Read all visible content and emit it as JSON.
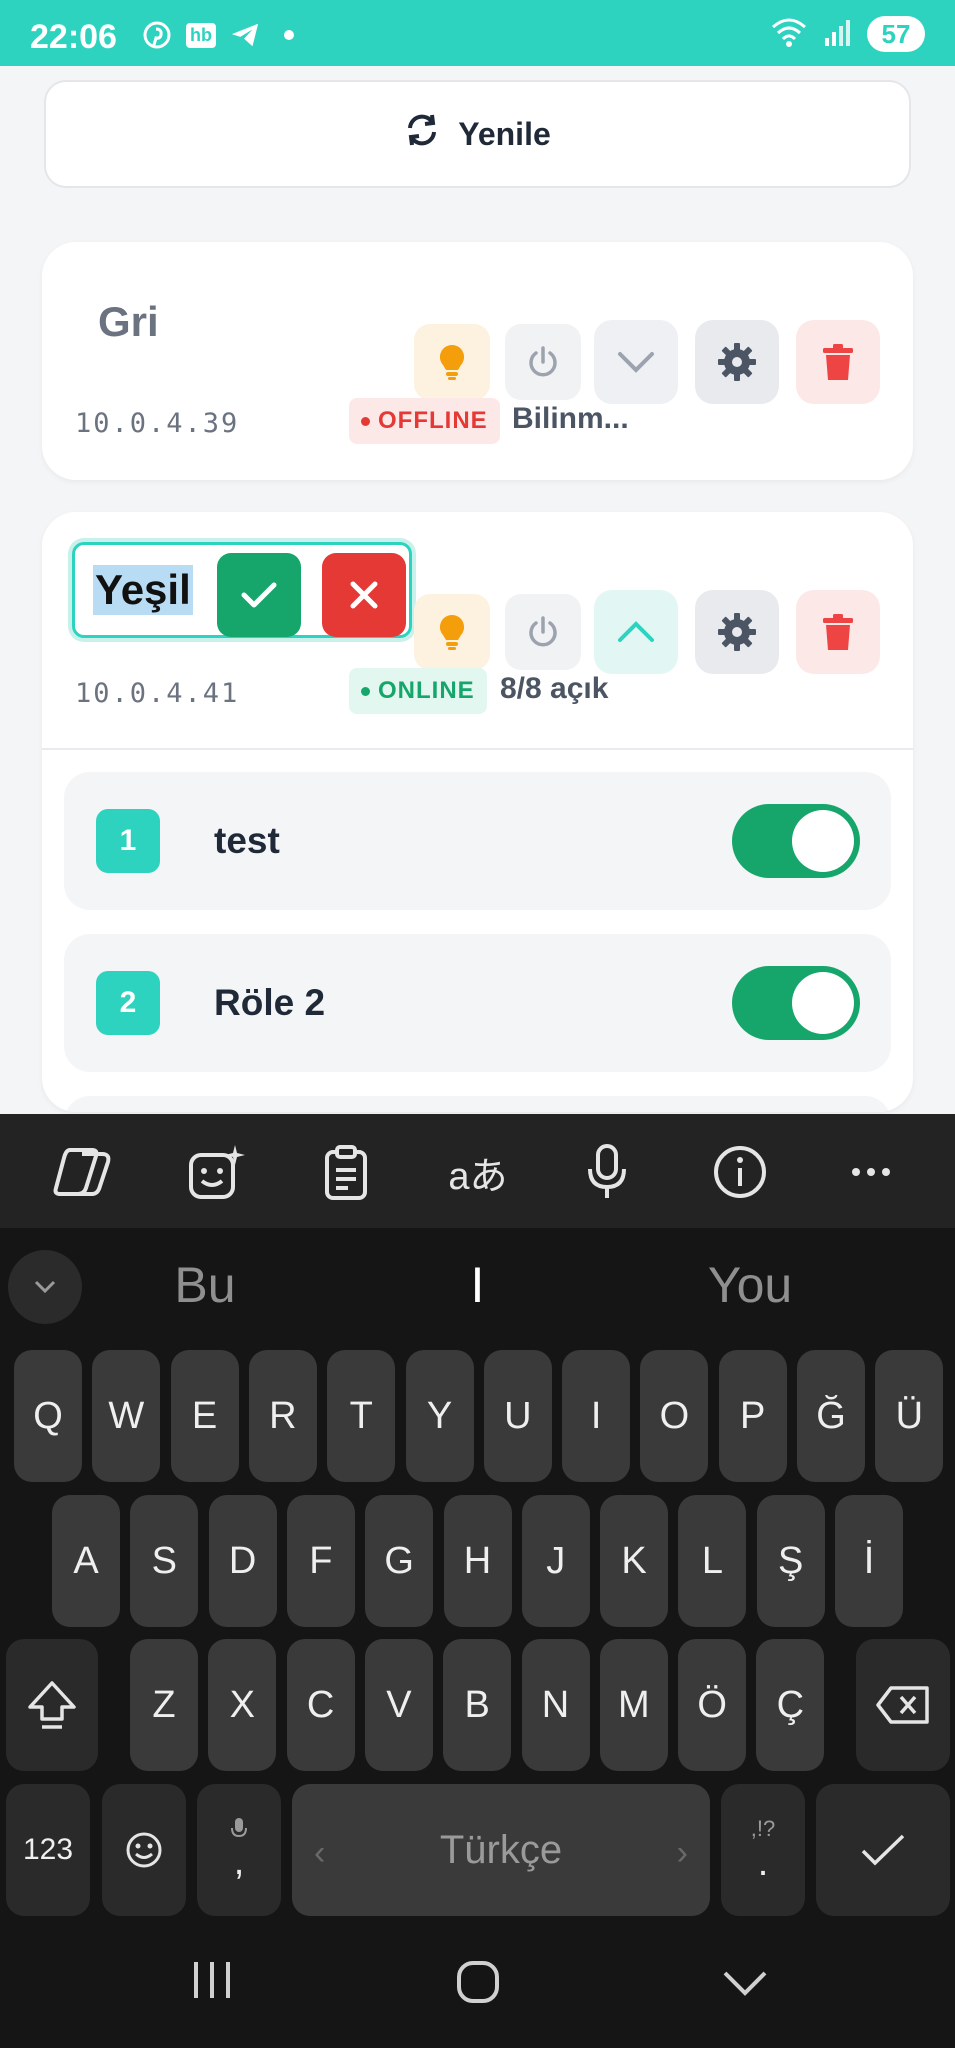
{
  "status_bar": {
    "time": "22:06",
    "battery": "57",
    "icons": [
      "pinterest-icon",
      "hb-icon",
      "telegram-icon",
      "dot-icon",
      "wifi-icon",
      "signal-icon"
    ],
    "hb_label": "hb"
  },
  "refresh": {
    "label": "Yenile"
  },
  "devices": [
    {
      "name": "Gri",
      "ip": "10.0.4.39",
      "status": "OFFLINE",
      "status_text": "Bilinm..."
    },
    {
      "name": "Yeşil",
      "ip": "10.0.4.41",
      "status": "ONLINE",
      "status_text": "8/8 açık",
      "relays": [
        {
          "num": "1",
          "label": "test",
          "on": true
        },
        {
          "num": "2",
          "label": "Röle 2",
          "on": true
        }
      ]
    }
  ],
  "keyboard": {
    "suggestions": [
      "Bu",
      "I",
      "You"
    ],
    "row1": [
      "Q",
      "W",
      "E",
      "R",
      "T",
      "Y",
      "U",
      "I",
      "O",
      "P",
      "Ğ",
      "Ü"
    ],
    "row2": [
      "A",
      "S",
      "D",
      "F",
      "G",
      "H",
      "J",
      "K",
      "L",
      "Ş",
      "İ"
    ],
    "row3": [
      "Z",
      "X",
      "C",
      "V",
      "B",
      "N",
      "M",
      "Ö",
      "Ç"
    ],
    "num_key": "123",
    "comma": ",",
    "period": ".",
    "punct_hint": ",!?",
    "space": "Türkçe"
  },
  "colors": {
    "accent": "#2ed3c0",
    "online": "#16a66b",
    "offline": "#e53935",
    "bulb": "#f59e0b"
  }
}
